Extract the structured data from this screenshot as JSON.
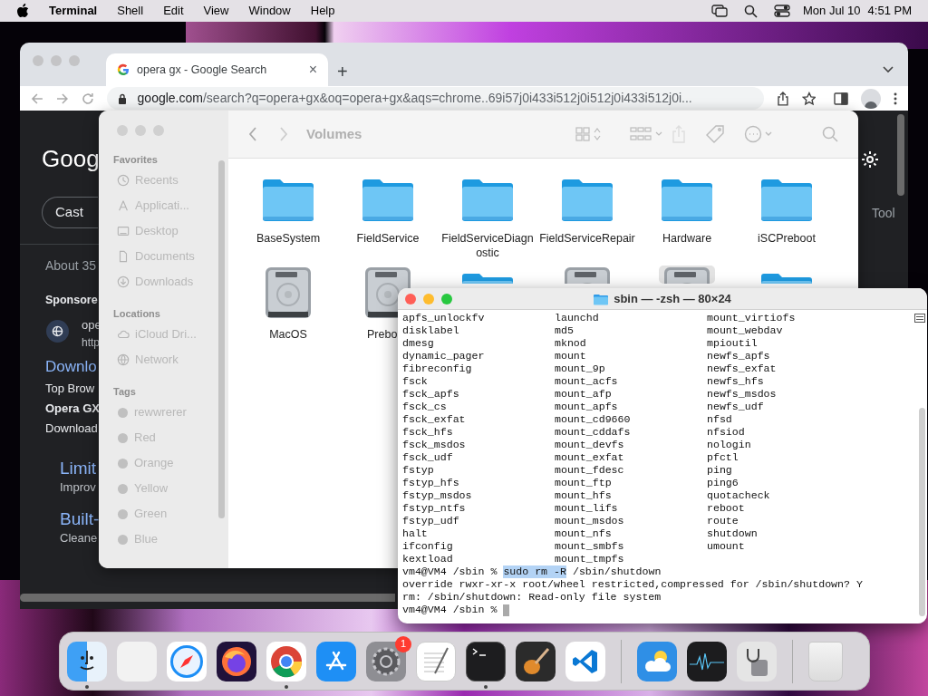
{
  "menubar": {
    "app": "Terminal",
    "menus": [
      "Shell",
      "Edit",
      "View",
      "Window",
      "Help"
    ],
    "date": "Mon Jul 10",
    "time": "4:51 PM"
  },
  "browser": {
    "tab": {
      "title": "opera gx - Google Search",
      "close": "×",
      "selected": true
    },
    "new_tab": "+",
    "address": {
      "host": "google.com",
      "path": "/search?q=opera+gx&oq=opera+gx&aqs=chrome..69i57j0i433i512j0i512j0i433i512j0i..."
    },
    "page_left": {
      "logo": "Goog",
      "chip": "Cast",
      "results": "About 35",
      "sponsored": "Sponsore",
      "ad_title": "ope",
      "ad_url": "http",
      "heading": "Downlo",
      "lines": [
        "Top Brow",
        "Opera GX",
        "Download"
      ],
      "sitelinks": [
        {
          "title": "Limit",
          "text": "Improv"
        },
        {
          "title": "Built-",
          "text": "Cleane"
        }
      ]
    },
    "page_right": {
      "tab": "Tool"
    }
  },
  "finder": {
    "title": "Volumes",
    "sidebar": [
      {
        "heading": "Favorites",
        "items": [
          {
            "label": "Recents",
            "kind": "clock"
          },
          {
            "label": "Applicati...",
            "kind": "apps"
          },
          {
            "label": "Desktop",
            "kind": "desktop"
          },
          {
            "label": "Documents",
            "kind": "doc"
          },
          {
            "label": "Downloads",
            "kind": "download"
          }
        ]
      },
      {
        "heading": "Locations",
        "items": [
          {
            "label": "iCloud Dri...",
            "kind": "cloud"
          },
          {
            "label": "Network",
            "kind": "globe"
          }
        ]
      },
      {
        "heading": "Tags",
        "items": [
          {
            "label": "rewwrerer",
            "kind": "tag"
          },
          {
            "label": "Red",
            "kind": "tag"
          },
          {
            "label": "Orange",
            "kind": "tag"
          },
          {
            "label": "Yellow",
            "kind": "tag"
          },
          {
            "label": "Green",
            "kind": "tag"
          },
          {
            "label": "Blue",
            "kind": "tag"
          }
        ]
      }
    ],
    "items": [
      {
        "label": "BaseSystem",
        "kind": "folder"
      },
      {
        "label": "FieldService",
        "kind": "folder"
      },
      {
        "label": "FieldServiceDiagnostic",
        "kind": "folder"
      },
      {
        "label": "FieldServiceRepair",
        "kind": "folder"
      },
      {
        "label": "Hardware",
        "kind": "folder"
      },
      {
        "label": "iSCPreboot",
        "kind": "folder"
      },
      {
        "label": "MacOS",
        "kind": "disk",
        "selected": false
      },
      {
        "label": "Prebo",
        "kind": "disk",
        "selected": false
      },
      {
        "kind": "folder",
        "selected": false
      },
      {
        "kind": "disk",
        "selected": false
      },
      {
        "kind": "disk",
        "selected": true
      },
      {
        "kind": "folder",
        "selected": false
      }
    ]
  },
  "terminal": {
    "title": "sbin — -zsh — 80×24",
    "rows": [
      [
        "apfs_unlockfv",
        "launchd",
        "mount_virtiofs"
      ],
      [
        "disklabel",
        "md5",
        "mount_webdav"
      ],
      [
        "dmesg",
        "mknod",
        "mpioutil"
      ],
      [
        "dynamic_pager",
        "mount",
        "newfs_apfs"
      ],
      [
        "fibreconfig",
        "mount_9p",
        "newfs_exfat"
      ],
      [
        "fsck",
        "mount_acfs",
        "newfs_hfs"
      ],
      [
        "fsck_apfs",
        "mount_afp",
        "newfs_msdos"
      ],
      [
        "fsck_cs",
        "mount_apfs",
        "newfs_udf"
      ],
      [
        "fsck_exfat",
        "mount_cd9660",
        "nfsd"
      ],
      [
        "fsck_hfs",
        "mount_cddafs",
        "nfsiod"
      ],
      [
        "fsck_msdos",
        "mount_devfs",
        "nologin"
      ],
      [
        "fsck_udf",
        "mount_exfat",
        "pfctl"
      ],
      [
        "fstyp",
        "mount_fdesc",
        "ping"
      ],
      [
        "fstyp_hfs",
        "mount_ftp",
        "ping6"
      ],
      [
        "fstyp_msdos",
        "mount_hfs",
        "quotacheck"
      ],
      [
        "fstyp_ntfs",
        "mount_lifs",
        "reboot"
      ],
      [
        "fstyp_udf",
        "mount_msdos",
        "route"
      ],
      [
        "halt",
        "mount_nfs",
        "shutdown"
      ],
      [
        "ifconfig",
        "mount_smbfs",
        "umount"
      ],
      [
        "kextload",
        "mount_tmpfs"
      ]
    ],
    "command": {
      "prompt": "vm4@VM4 /sbin %",
      "selection": "sudo rm -R",
      "rest": "/sbin/shutdown"
    },
    "output": [
      "override rwxr-xr-x root/wheel restricted,compressed for /sbin/shutdown? Y",
      "rm: /sbin/shutdown: Read-only file system"
    ],
    "prompt": "vm4@VM4 /sbin %"
  },
  "dock": [
    {
      "kind": "finder",
      "running": true
    },
    {
      "kind": "launchpad",
      "running": false
    },
    {
      "kind": "safari",
      "running": false
    },
    {
      "kind": "firefox",
      "running": false
    },
    {
      "kind": "chrome",
      "running": true
    },
    {
      "kind": "appstore",
      "running": false
    },
    {
      "kind": "settings",
      "running": false,
      "badge": "1"
    },
    {
      "kind": "textedit",
      "running": false
    },
    {
      "kind": "terminal",
      "running": true
    },
    {
      "kind": "guitar",
      "running": false
    },
    {
      "kind": "vscode",
      "running": false
    },
    {
      "kind": "separator"
    },
    {
      "kind": "weather",
      "running": false
    },
    {
      "kind": "activity",
      "running": false
    },
    {
      "kind": "diskutility",
      "running": false
    },
    {
      "kind": "separator"
    },
    {
      "kind": "trash",
      "running": false
    }
  ]
}
